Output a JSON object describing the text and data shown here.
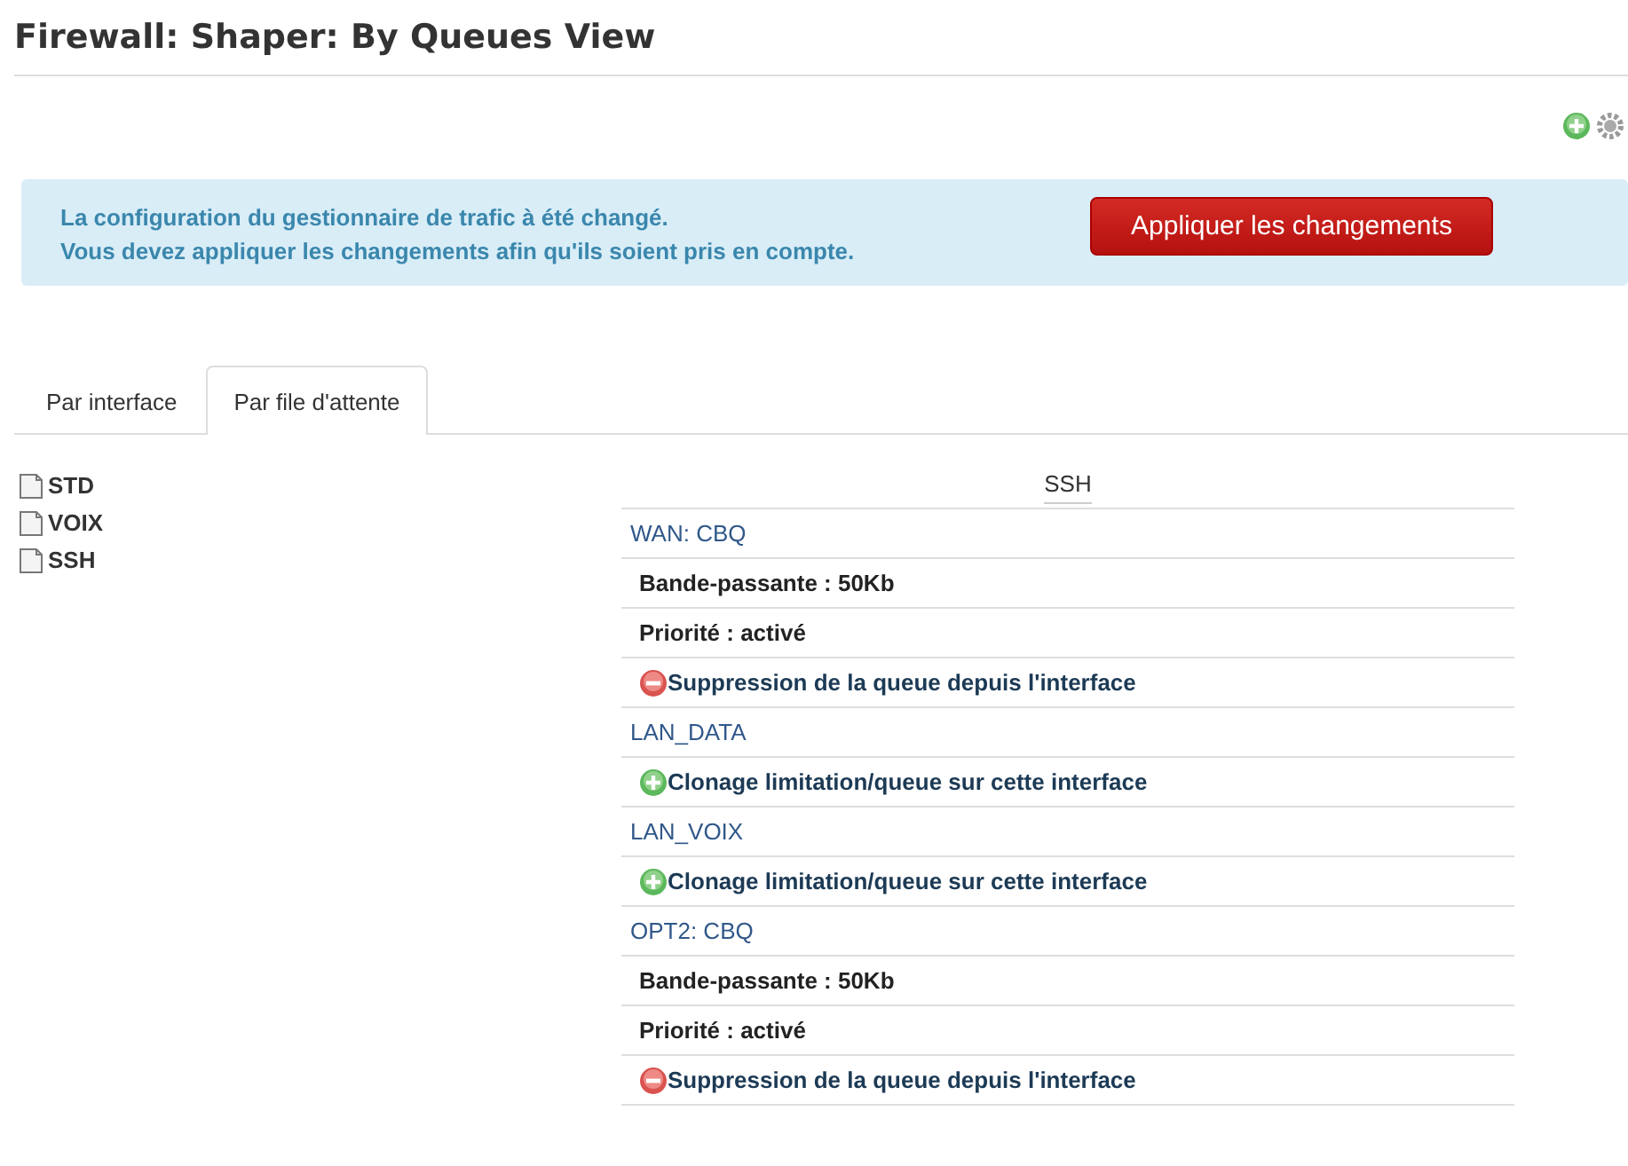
{
  "page_title": "Firewall: Shaper: By Queues View",
  "alert": {
    "lines": [
      "La configuration du gestionnaire de trafic à été changé.",
      "Vous devez appliquer les changements afin qu'ils soient pris en compte."
    ],
    "button": "Appliquer les changements"
  },
  "tabs": [
    {
      "label": "Par interface",
      "selected": false
    },
    {
      "label": "Par file d'attente",
      "selected": true
    }
  ],
  "tree": {
    "items": [
      {
        "label": "STD"
      },
      {
        "label": "VOIX"
      },
      {
        "label": "SSH"
      }
    ]
  },
  "queue_table": {
    "title": "SSH",
    "rows": [
      {
        "kind": "header",
        "text": "WAN: CBQ"
      },
      {
        "kind": "info",
        "text": "Bande-passante : 50Kb"
      },
      {
        "kind": "info",
        "text": "Priorité : activé"
      },
      {
        "kind": "remove",
        "text": "Suppression de la queue depuis l'interface"
      },
      {
        "kind": "header",
        "text": "LAN_DATA"
      },
      {
        "kind": "clone",
        "text": "Clonage limitation/queue sur cette interface"
      },
      {
        "kind": "header",
        "text": "LAN_VOIX"
      },
      {
        "kind": "clone",
        "text": "Clonage limitation/queue sur cette interface"
      },
      {
        "kind": "header",
        "text": "OPT2: CBQ"
      },
      {
        "kind": "info",
        "text": "Bande-passante : 50Kb"
      },
      {
        "kind": "info",
        "text": "Priorité : activé"
      },
      {
        "kind": "remove",
        "text": "Suppression de la queue depuis l'interface"
      }
    ]
  }
}
